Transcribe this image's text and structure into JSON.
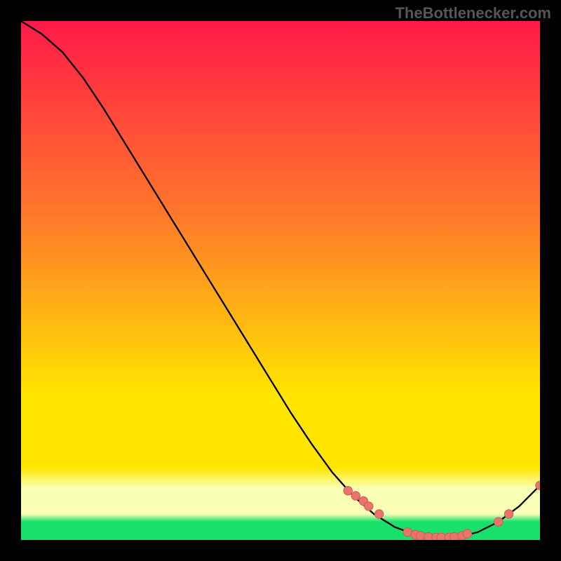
{
  "watermark": "TheBottlenecker.com",
  "chart_data": {
    "type": "line",
    "title": "",
    "xlabel": "",
    "ylabel": "",
    "xlim": [
      0,
      100
    ],
    "ylim": [
      0,
      100
    ],
    "x": [
      0,
      4,
      8,
      12,
      16,
      20,
      24,
      28,
      32,
      36,
      40,
      44,
      48,
      52,
      56,
      60,
      64,
      68,
      72,
      76,
      80,
      84,
      88,
      92,
      96,
      100
    ],
    "y": [
      100,
      97.5,
      94,
      89,
      83,
      76.5,
      70,
      63.5,
      57,
      50.5,
      44,
      37.5,
      31,
      24.5,
      18.5,
      13,
      8.5,
      5,
      2.5,
      1,
      0.5,
      0.5,
      1.5,
      3.5,
      6.5,
      10.5
    ],
    "markers": {
      "x": [
        63,
        64.5,
        66,
        67,
        69,
        74.5,
        76,
        77,
        78.5,
        80,
        81,
        82.5,
        83.5,
        85,
        86,
        92,
        94,
        100
      ],
      "y": [
        9.5,
        8.5,
        7.5,
        6.5,
        5,
        1.5,
        1,
        0.8,
        0.6,
        0.5,
        0.5,
        0.5,
        0.6,
        0.8,
        1.2,
        3.5,
        5,
        10.5
      ]
    },
    "gradient_top": "#ff1a48",
    "gradient_mid1": "#ff7a2a",
    "gradient_mid2": "#ffe500",
    "gradient_band_pale": "#f9ffb4",
    "gradient_band_green": "#18e06b",
    "marker_fill": "#e9746c",
    "marker_stroke": "#d15a55",
    "line_color": "#000000"
  }
}
